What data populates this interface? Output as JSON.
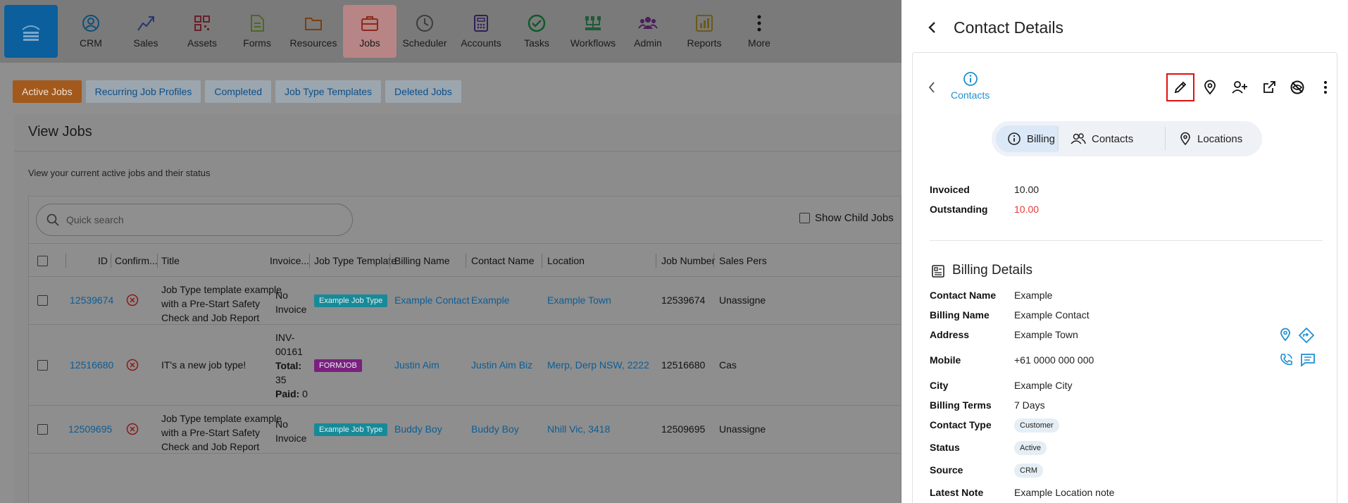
{
  "nav": {
    "items": [
      {
        "label": "CRM",
        "icon": "crm-icon"
      },
      {
        "label": "Sales",
        "icon": "sales-icon"
      },
      {
        "label": "Assets",
        "icon": "assets-icon"
      },
      {
        "label": "Forms",
        "icon": "forms-icon"
      },
      {
        "label": "Resources",
        "icon": "resources-icon"
      },
      {
        "label": "Jobs",
        "icon": "jobs-icon"
      },
      {
        "label": "Scheduler",
        "icon": "scheduler-icon"
      },
      {
        "label": "Accounts",
        "icon": "accounts-icon"
      },
      {
        "label": "Tasks",
        "icon": "tasks-icon"
      },
      {
        "label": "Workflows",
        "icon": "workflows-icon"
      },
      {
        "label": "Admin",
        "icon": "admin-icon"
      },
      {
        "label": "Reports",
        "icon": "reports-icon"
      },
      {
        "label": "More",
        "icon": "more-icon"
      }
    ],
    "active": "Jobs"
  },
  "subtabs": [
    "Active Jobs",
    "Recurring Job Profiles",
    "Completed",
    "Job Type Templates",
    "Deleted Jobs"
  ],
  "view": {
    "title": "View Jobs",
    "description": "View your current active jobs and their status",
    "search_placeholder": "Quick search",
    "show_child_label": "Show Child Jobs"
  },
  "table": {
    "headers": [
      "ID",
      "Confirm...",
      "Title",
      "Invoice...",
      "Job Type Template",
      "Billing Name",
      "Contact Name",
      "Location",
      "Job Number",
      "Sales Pers"
    ],
    "rows": [
      {
        "id": "12539674",
        "title_lines": [
          "Job Type template example",
          "with a Pre-Start Safety",
          "Check and Job Report"
        ],
        "invoice_lines": [
          "No",
          "Invoice"
        ],
        "template": "Example Job Type",
        "billing": "Example Contact",
        "contact": "Example",
        "location": "Example Town",
        "job_number": "12539674",
        "sales": "Unassigne"
      },
      {
        "id": "12516680",
        "title_lines": [
          "IT's a new job type!"
        ],
        "invoice_lines": [
          "INV-",
          "00161"
        ],
        "total_label": "Total:",
        "total_value": "35",
        "paid_label": "Paid:",
        "paid_value": "0",
        "template": "FORMJOB",
        "billing": "Justin Aim",
        "contact": "Justin Aim Biz",
        "location": "Merp, Derp NSW, 2222",
        "job_number": "12516680",
        "sales": "Cas"
      },
      {
        "id": "12509695",
        "title_lines": [
          "Job Type template example",
          "with a Pre-Start Safety",
          "Check and Job Report"
        ],
        "invoice_lines": [
          "No",
          "Invoice"
        ],
        "template": "Example Job Type",
        "billing": "Buddy Boy",
        "contact": "Buddy Boy",
        "location": "Nhill Vic, 3418",
        "job_number": "12509695",
        "sales": "Unassigne"
      }
    ]
  },
  "panel": {
    "title": "Contact Details",
    "contacts_link": "Contacts",
    "segments": [
      "Billing",
      "Contacts",
      "Locations"
    ],
    "invoiced_label": "Invoiced",
    "invoiced_value": "10.00",
    "outstanding_label": "Outstanding",
    "outstanding_value": "10.00",
    "billing_details_title": "Billing Details",
    "fields": {
      "contact_name": {
        "label": "Contact Name",
        "value": "Example"
      },
      "billing_name": {
        "label": "Billing Name",
        "value": "Example Contact"
      },
      "address": {
        "label": "Address",
        "value": "Example Town"
      },
      "mobile": {
        "label": "Mobile",
        "value": "+61 0000 000 000"
      },
      "city": {
        "label": "City",
        "value": "Example City"
      },
      "billing_terms": {
        "label": "Billing Terms",
        "value": "7 Days"
      },
      "contact_type": {
        "label": "Contact Type",
        "value": "Customer"
      },
      "status": {
        "label": "Status",
        "value": "Active"
      },
      "source": {
        "label": "Source",
        "value": "CRM"
      },
      "latest_note": {
        "label": "Latest Note",
        "value": "Example Location note"
      }
    }
  },
  "colors": {
    "accent": "#1f8fd0",
    "outstanding": "#e53935",
    "highlight_border": "#e01010",
    "active_subtab": "#a2591b",
    "badge_teal": "#178a99",
    "badge_purple": "#7b1f80"
  }
}
